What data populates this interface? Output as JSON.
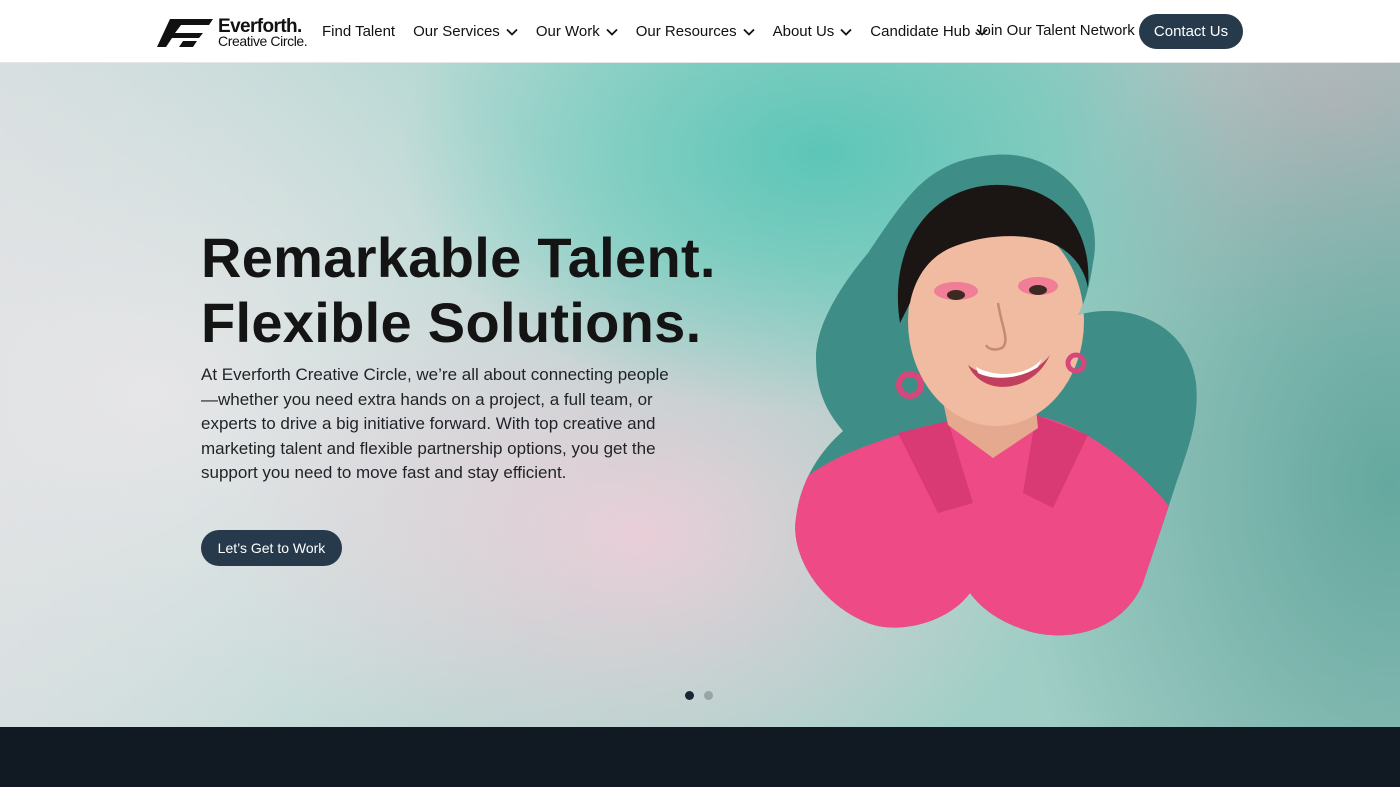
{
  "header": {
    "logo": {
      "line1": "Everforth.",
      "line2": "Creative Circle."
    },
    "nav": [
      {
        "label": "Find Talent",
        "dropdown": false
      },
      {
        "label": "Our Services",
        "dropdown": true
      },
      {
        "label": "Our Work",
        "dropdown": true
      },
      {
        "label": "Our Resources",
        "dropdown": true
      },
      {
        "label": "About Us",
        "dropdown": true
      },
      {
        "label": "Candidate Hub",
        "dropdown": true
      }
    ],
    "talent_network_link": "Join Our Talent Network",
    "contact_button": "Contact Us"
  },
  "hero": {
    "headline_line1_light": "Remarkable ",
    "headline_line1_bold": "Talent.",
    "headline_line2_light": "Flexible ",
    "headline_line2_bold": "Solutions.",
    "body": "At Everforth Creative Circle, we’re all about connecting people—whether you need extra hands on a project, a full team, or experts to drive a big initiative forward. With top creative and marketing talent and flexible partnership options, you get the support you need to move fast and stay efficient.",
    "cta_button": "Let’s Get to Work",
    "carousel": {
      "slide_count": 2,
      "active_index": 0
    }
  },
  "colors": {
    "primary_dark": "#263a4b",
    "footer_band": "#111923",
    "portrait_blob": "#3f8d87",
    "shirt_pink": "#ee4a86"
  },
  "icons": [
    "logo-mark-icon",
    "chevron-down-icon",
    "portrait-image"
  ]
}
